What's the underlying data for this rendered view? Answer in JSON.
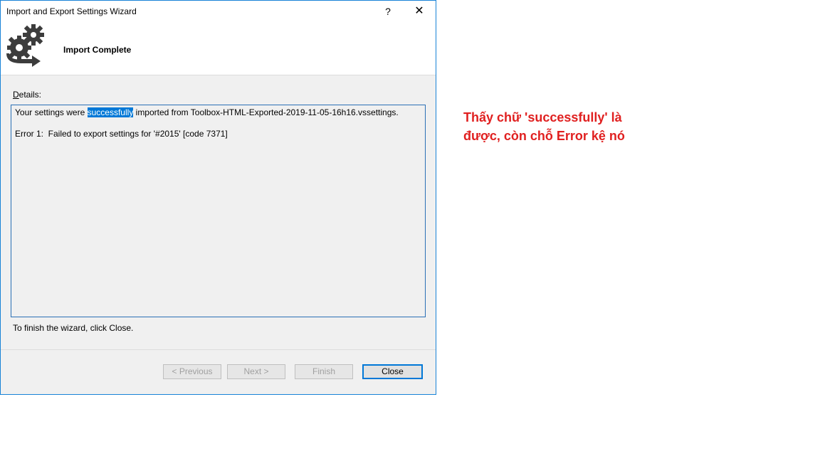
{
  "window": {
    "title": "Import and Export Settings Wizard",
    "help_glyph": "?",
    "close_glyph": "✕"
  },
  "header": {
    "icon": "gears-arrow-icon",
    "title": "Import Complete"
  },
  "details": {
    "label_prefix": "D",
    "label_rest": "etails:",
    "line1_before": "Your settings were ",
    "line1_highlight": "successfully",
    "line1_after": " imported from Toolbox-HTML-Exported-2019-11-05-16h16.vssettings.",
    "line2": "Error 1:  Failed to export settings for '#2015' [code 7371]"
  },
  "finish_hint": "To finish the wizard, click Close.",
  "buttons": {
    "previous": "< Previous",
    "next": "Next >",
    "finish": "Finish",
    "close": "Close"
  },
  "annotation": "Thấy chữ 'successfully' là được, còn chỗ Error kệ nó",
  "colors": {
    "accent": "#0078d7",
    "annotation": "#e02020",
    "border": "#1883d7"
  }
}
